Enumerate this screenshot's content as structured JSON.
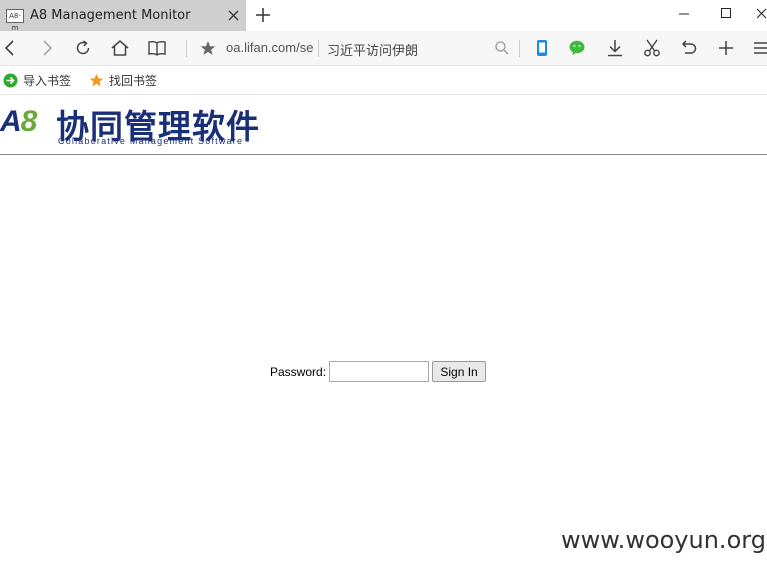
{
  "browser": {
    "tab": {
      "favicon_text": "A8-m",
      "title": "A8 Management Monitor"
    },
    "address": {
      "url": "oa.lifan.com/se",
      "search_hint": "习近平访问伊朗"
    },
    "bookmarks": [
      {
        "label": "导入书签",
        "icon": "import-arrow-icon",
        "color": "#2eaa2e"
      },
      {
        "label": "找回书签",
        "icon": "star-icon",
        "color": "#f29a1f"
      }
    ]
  },
  "page": {
    "logo": {
      "mark_a": "A",
      "mark_8": "8",
      "title_cn": "协同管理软件",
      "subtitle_en": "Collaborative Management Software"
    },
    "login": {
      "password_label": "Password:",
      "password_value": "",
      "sign_in_label": "Sign In"
    },
    "watermark": "www.wooyun.org"
  },
  "colors": {
    "brand_blue": "#1a2f7a",
    "brand_green": "#6aa93a",
    "phone_icon": "#1e88e5",
    "wechat_icon": "#3dbb3d"
  }
}
